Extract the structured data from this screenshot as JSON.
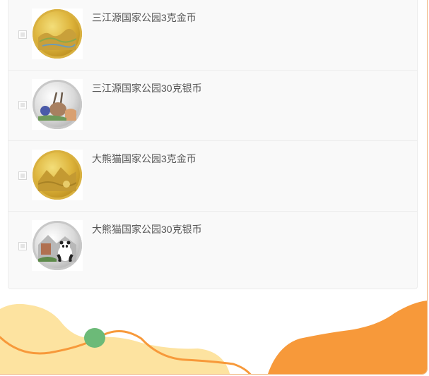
{
  "products": [
    {
      "title": "三江源国家公园3克金币",
      "coin": "gold",
      "icon": "gold-coin-landscape"
    },
    {
      "title": "三江源国家公园30克银币",
      "coin": "silver",
      "icon": "silver-coin-antelope"
    },
    {
      "title": "大熊猫国家公园3克金币",
      "coin": "gold",
      "icon": "gold-coin-mountains"
    },
    {
      "title": "大熊猫国家公园30克银币",
      "coin": "silver",
      "icon": "silver-coin-panda"
    }
  ],
  "colors": {
    "accent_orange": "#f7993a",
    "light_yellow": "#fde3a0",
    "green_dot": "#6cba78",
    "panel_bg": "#f9f9f9"
  }
}
